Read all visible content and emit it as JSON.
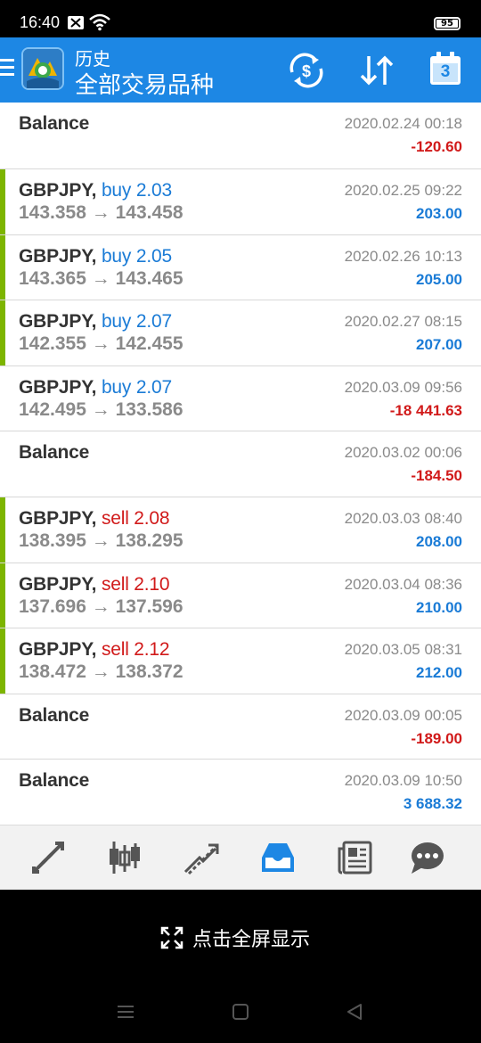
{
  "status": {
    "time": "16:40",
    "battery": "95"
  },
  "header": {
    "subtitle": "历史",
    "title": "全部交易品种",
    "icons": [
      "symbol-filter-icon",
      "sort-icon",
      "calendar-icon"
    ],
    "calendar_day": "3"
  },
  "colors": {
    "header_bg": "#1d87e4",
    "positive": "#1a7bd6",
    "negative": "#d11a1a",
    "trade_bar": "#7db500"
  },
  "rows": [
    {
      "kind": "balance",
      "label": "Balance",
      "date": "2020.02.24 00:18",
      "amount": "-120.60",
      "sign": "neg"
    },
    {
      "kind": "trade",
      "symbol": "GBPJPY,",
      "side": "buy 2.03",
      "dir": "buy",
      "open": "143.358",
      "arrow": "→",
      "close": "143.458",
      "date": "2020.02.25 09:22",
      "amount": "203.00",
      "sign": "pos"
    },
    {
      "kind": "trade",
      "symbol": "GBPJPY,",
      "side": "buy 2.05",
      "dir": "buy",
      "open": "143.365",
      "arrow": "→",
      "close": "143.465",
      "date": "2020.02.26 10:13",
      "amount": "205.00",
      "sign": "pos"
    },
    {
      "kind": "trade",
      "symbol": "GBPJPY,",
      "side": "buy 2.07",
      "dir": "buy",
      "open": "142.355",
      "arrow": "→",
      "close": "142.455",
      "date": "2020.02.27 08:15",
      "amount": "207.00",
      "sign": "pos"
    },
    {
      "kind": "trade-nobar",
      "symbol": "GBPJPY,",
      "side": "buy 2.07",
      "dir": "buy",
      "open": "142.495",
      "arrow": "→",
      "close": "133.586",
      "date": "2020.03.09 09:56",
      "amount": "-18 441.63",
      "sign": "neg"
    },
    {
      "kind": "balance",
      "label": "Balance",
      "date": "2020.03.02 00:06",
      "amount": "-184.50",
      "sign": "neg"
    },
    {
      "kind": "trade",
      "symbol": "GBPJPY,",
      "side": "sell 2.08",
      "dir": "sell",
      "open": "138.395",
      "arrow": "→",
      "close": "138.295",
      "date": "2020.03.03 08:40",
      "amount": "208.00",
      "sign": "pos"
    },
    {
      "kind": "trade",
      "symbol": "GBPJPY,",
      "side": "sell 2.10",
      "dir": "sell",
      "open": "137.696",
      "arrow": "→",
      "close": "137.596",
      "date": "2020.03.04 08:36",
      "amount": "210.00",
      "sign": "pos"
    },
    {
      "kind": "trade",
      "symbol": "GBPJPY,",
      "side": "sell 2.12",
      "dir": "sell",
      "open": "138.472",
      "arrow": "→",
      "close": "138.372",
      "date": "2020.03.05 08:31",
      "amount": "212.00",
      "sign": "pos"
    },
    {
      "kind": "balance",
      "label": "Balance",
      "date": "2020.03.09 00:05",
      "amount": "-189.00",
      "sign": "neg"
    },
    {
      "kind": "balance",
      "label": "Balance",
      "date": "2020.03.09 10:50",
      "amount": "3 688.32",
      "sign": "pos"
    }
  ],
  "tabs": [
    {
      "icon": "quotes-icon",
      "active": false
    },
    {
      "icon": "chart-icon",
      "active": false
    },
    {
      "icon": "trade-icon",
      "active": false
    },
    {
      "icon": "history-icon",
      "active": true
    },
    {
      "icon": "news-icon",
      "active": false
    },
    {
      "icon": "chat-icon",
      "active": false
    }
  ],
  "fullscreen": {
    "label": "点击全屏显示"
  }
}
